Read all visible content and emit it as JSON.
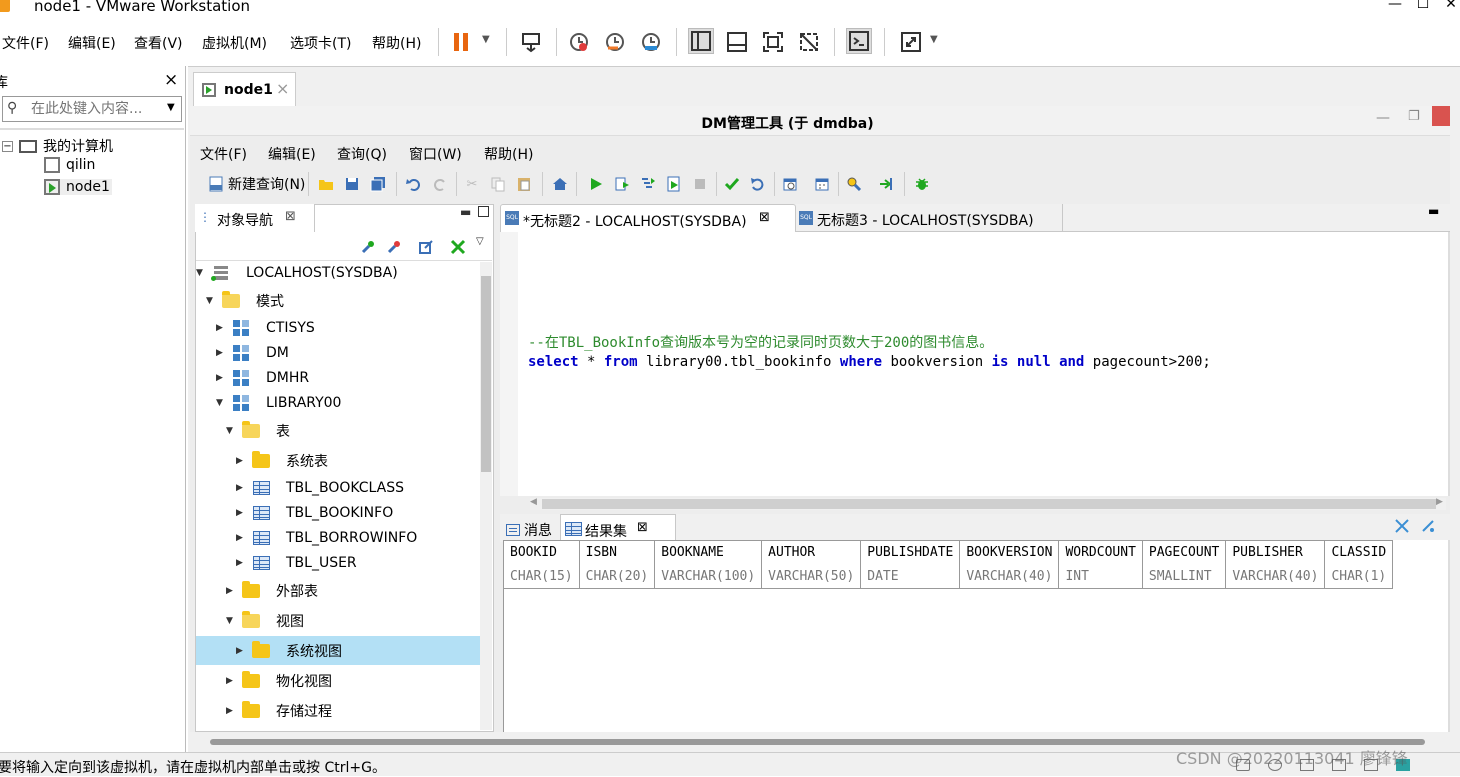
{
  "window": {
    "title": "node1 - VMware Workstation"
  },
  "vm_menu": [
    "文件(F)",
    "编辑(E)",
    "查看(V)",
    "虚拟机(M)",
    "选项卡(T)",
    "帮助(H)"
  ],
  "library": {
    "title": "库",
    "close": "×",
    "search_placeholder": "在此处键入内容...",
    "root": "我的计算机",
    "vms": [
      "qilin",
      "node1"
    ]
  },
  "vm_tab": {
    "label": "node1",
    "close": "×"
  },
  "dm": {
    "title": "DM管理工具 (于 dmdba)",
    "menu": [
      "文件(F)",
      "编辑(E)",
      "查询(Q)",
      "窗口(W)",
      "帮助(H)"
    ],
    "new_query": "新建查询(N)"
  },
  "navigator": {
    "tab": "对象导航",
    "tab_close": "⊠",
    "connection": "LOCALHOST(SYSDBA)",
    "schema_group": "模式",
    "schemas": [
      "CTISYS",
      "DM",
      "DMHR",
      "LIBRARY00"
    ],
    "tables_group": "表",
    "system_tables": "系统表",
    "tables": [
      "TBL_BOOKCLASS",
      "TBL_BOOKINFO",
      "TBL_BORROWINFO",
      "TBL_USER"
    ],
    "external_tables": "外部表",
    "views": "视图",
    "system_views": "系统视图",
    "materialized_views": "物化视图",
    "procedures": "存储过程"
  },
  "editor": {
    "tabs": [
      "*无标题2 - LOCALHOST(SYSDBA)",
      "无标题3 - LOCALHOST(SYSDBA)"
    ],
    "comment": "--在TBL_BookInfo查询版本号为空的记录同时页数大于200的图书信息。",
    "sql": {
      "k_select": "select",
      "t1": " * ",
      "k_from": "from",
      "t2": " library00.tbl_bookinfo ",
      "k_where": "where",
      "t3": " bookversion ",
      "k_is": "is",
      "t4": " ",
      "k_null": "null",
      "t5": " ",
      "k_and": "and",
      "t6": " pagecount>200;"
    }
  },
  "results": {
    "tabs": [
      "消息",
      "结果集"
    ],
    "columns": [
      {
        "name": "BOOKID",
        "type": "CHAR(15)"
      },
      {
        "name": "ISBN",
        "type": "CHAR(20)"
      },
      {
        "name": "BOOKNAME",
        "type": "VARCHAR(100)"
      },
      {
        "name": "AUTHOR",
        "type": "VARCHAR(50)"
      },
      {
        "name": "PUBLISHDATE",
        "type": "DATE"
      },
      {
        "name": "BOOKVERSION",
        "type": "VARCHAR(40)"
      },
      {
        "name": "WORDCOUNT",
        "type": "INT"
      },
      {
        "name": "PAGECOUNT",
        "type": "SMALLINT"
      },
      {
        "name": "PUBLISHER",
        "type": "VARCHAR(40)"
      },
      {
        "name": "CLASSID",
        "type": "CHAR(1)"
      }
    ]
  },
  "status": {
    "text": "要将输入定向到该虚拟机，请在虚拟机内部单击或按 Ctrl+G。"
  },
  "watermark": "CSDN @20220113041 廖锋锋",
  "colors": {
    "selection": "#b3e0f5",
    "keyword": "#0000c8",
    "comment": "#2e8b2e",
    "pause": "#e8650f"
  }
}
